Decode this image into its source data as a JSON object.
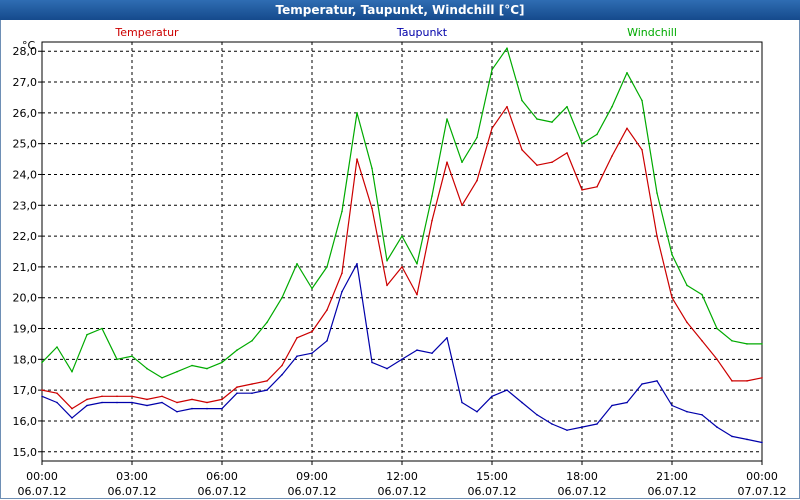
{
  "window": {
    "title": "Temperatur, Taupunkt, Windchill [°C]"
  },
  "chart_data": {
    "type": "line",
    "title": "Temperatur, Taupunkt, Windchill [°C]",
    "ylabel": "°C",
    "ylim": [
      14.7,
      28.3
    ],
    "xlim": [
      0,
      24
    ],
    "grid": true,
    "legend": "top",
    "yticks": [
      "15,0",
      "16,0",
      "17,0",
      "18,0",
      "19,0",
      "20,0",
      "21,0",
      "22,0",
      "23,0",
      "24,0",
      "25,0",
      "26,0",
      "27,0",
      "28,0"
    ],
    "xticks": [
      {
        "time": "00:00",
        "date": "06.07.12"
      },
      {
        "time": "03:00",
        "date": "06.07.12"
      },
      {
        "time": "06:00",
        "date": "06.07.12"
      },
      {
        "time": "09:00",
        "date": "06.07.12"
      },
      {
        "time": "12:00",
        "date": "06.07.12"
      },
      {
        "time": "15:00",
        "date": "06.07.12"
      },
      {
        "time": "18:00",
        "date": "06.07.12"
      },
      {
        "time": "21:00",
        "date": "06.07.12"
      },
      {
        "time": "00:00",
        "date": "07.07.12"
      }
    ],
    "series": [
      {
        "name": "Temperatur",
        "color": "#cc0000",
        "x": [
          0,
          0.5,
          1,
          1.5,
          2,
          2.5,
          3,
          3.5,
          4,
          4.5,
          5,
          5.5,
          6,
          6.5,
          7,
          7.5,
          8,
          8.5,
          9,
          9.5,
          10,
          10.5,
          11,
          11.5,
          12,
          12.5,
          13,
          13.5,
          14,
          14.5,
          15,
          15.5,
          16,
          16.5,
          17,
          17.5,
          18,
          18.5,
          19,
          19.5,
          20,
          20.5,
          21,
          21.5,
          22,
          22.5,
          23,
          23.5,
          24
        ],
        "values": [
          17.0,
          16.9,
          16.4,
          16.7,
          16.8,
          16.8,
          16.8,
          16.7,
          16.8,
          16.6,
          16.7,
          16.6,
          16.7,
          17.1,
          17.2,
          17.3,
          17.8,
          18.7,
          18.9,
          19.6,
          20.8,
          24.5,
          22.9,
          20.4,
          21.0,
          20.1,
          22.5,
          24.4,
          23.0,
          23.8,
          25.5,
          26.2,
          24.8,
          24.3,
          24.4,
          24.7,
          23.5,
          23.6,
          24.6,
          25.5,
          24.8,
          22.0,
          20.0,
          19.2,
          18.6,
          18.0,
          17.3,
          17.3,
          17.4
        ]
      },
      {
        "name": "Taupunkt",
        "color": "#0000aa",
        "x": [
          0,
          0.5,
          1,
          1.5,
          2,
          2.5,
          3,
          3.5,
          4,
          4.5,
          5,
          5.5,
          6,
          6.5,
          7,
          7.5,
          8,
          8.5,
          9,
          9.5,
          10,
          10.5,
          11,
          11.5,
          12,
          12.5,
          13,
          13.5,
          14,
          14.5,
          15,
          15.5,
          16,
          16.5,
          17,
          17.5,
          18,
          18.5,
          19,
          19.5,
          20,
          20.5,
          21,
          21.5,
          22,
          22.5,
          23,
          23.5,
          24
        ],
        "values": [
          16.8,
          16.6,
          16.1,
          16.5,
          16.6,
          16.6,
          16.6,
          16.5,
          16.6,
          16.3,
          16.4,
          16.4,
          16.4,
          16.9,
          16.9,
          17.0,
          17.5,
          18.1,
          18.2,
          18.6,
          20.2,
          21.1,
          17.9,
          17.7,
          18.0,
          18.3,
          18.2,
          18.7,
          16.6,
          16.3,
          16.8,
          17.0,
          16.6,
          16.2,
          15.9,
          15.7,
          15.8,
          15.9,
          16.5,
          16.6,
          17.2,
          17.3,
          16.5,
          16.3,
          16.2,
          15.8,
          15.5,
          15.4,
          15.3
        ]
      },
      {
        "name": "Windchill",
        "color": "#00aa00",
        "x": [
          0,
          0.5,
          1,
          1.5,
          2,
          2.5,
          3,
          3.5,
          4,
          4.5,
          5,
          5.5,
          6,
          6.5,
          7,
          7.5,
          8,
          8.5,
          9,
          9.5,
          10,
          10.5,
          11,
          11.5,
          12,
          12.5,
          13,
          13.5,
          14,
          14.5,
          15,
          15.5,
          16,
          16.5,
          17,
          17.5,
          18,
          18.5,
          19,
          19.5,
          20,
          20.5,
          21,
          21.5,
          22,
          22.5,
          23,
          23.5,
          24
        ],
        "values": [
          17.9,
          18.4,
          17.6,
          18.8,
          19.0,
          18.0,
          18.1,
          17.7,
          17.4,
          17.6,
          17.8,
          17.7,
          17.9,
          18.3,
          18.6,
          19.2,
          20.0,
          21.1,
          20.3,
          21.0,
          22.8,
          26.0,
          24.2,
          21.2,
          22.0,
          21.1,
          23.3,
          25.8,
          24.4,
          25.2,
          27.4,
          28.1,
          26.4,
          25.8,
          25.7,
          26.2,
          25.0,
          25.3,
          26.2,
          27.3,
          26.4,
          23.4,
          21.4,
          20.4,
          20.1,
          19.0,
          18.6,
          18.5,
          18.5
        ]
      }
    ]
  }
}
